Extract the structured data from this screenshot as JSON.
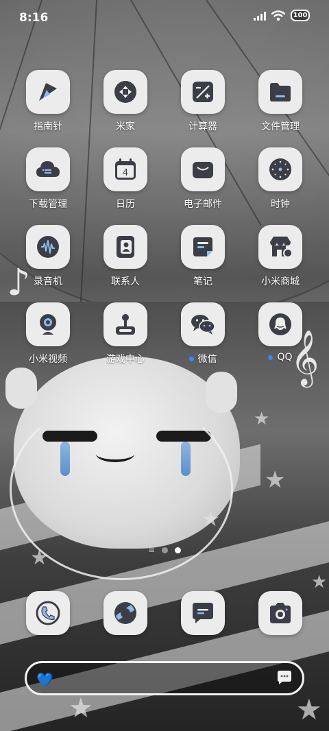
{
  "status_bar": {
    "time": "8:16",
    "battery": "100"
  },
  "apps": [
    {
      "label": "指南针",
      "icon": "compass-icon",
      "dot": false
    },
    {
      "label": "米家",
      "icon": "mijia-icon",
      "dot": false
    },
    {
      "label": "计算器",
      "icon": "calculator-icon",
      "dot": false
    },
    {
      "label": "文件管理",
      "icon": "folder-icon",
      "dot": false
    },
    {
      "label": "下载管理",
      "icon": "download-cloud-icon",
      "dot": false
    },
    {
      "label": "日历",
      "icon": "calendar-icon",
      "dot": false,
      "glyph": "4"
    },
    {
      "label": "电子邮件",
      "icon": "mail-icon",
      "dot": false
    },
    {
      "label": "时钟",
      "icon": "clock-icon",
      "dot": false
    },
    {
      "label": "录音机",
      "icon": "recorder-icon",
      "dot": false
    },
    {
      "label": "联系人",
      "icon": "contacts-icon",
      "dot": false
    },
    {
      "label": "笔记",
      "icon": "notes-icon",
      "dot": false
    },
    {
      "label": "小米商城",
      "icon": "store-icon",
      "dot": false
    },
    {
      "label": "小米视频",
      "icon": "video-camera-icon",
      "dot": false
    },
    {
      "label": "游戏中心",
      "icon": "joystick-icon",
      "dot": false
    },
    {
      "label": "微信",
      "icon": "wechat-icon",
      "dot": true
    },
    {
      "label": "QQ",
      "icon": "qq-icon",
      "dot": true
    }
  ],
  "dock": [
    {
      "icon": "phone-icon"
    },
    {
      "icon": "browser-icon"
    },
    {
      "icon": "messages-icon"
    },
    {
      "icon": "camera-icon"
    }
  ],
  "pager": {
    "pages": 2,
    "active": 1
  },
  "colors": {
    "tile": "#ececec",
    "icon_dark": "#3b3e46",
    "accent_blue": "#8fb8ea",
    "notification_dot": "#3a86ff"
  }
}
